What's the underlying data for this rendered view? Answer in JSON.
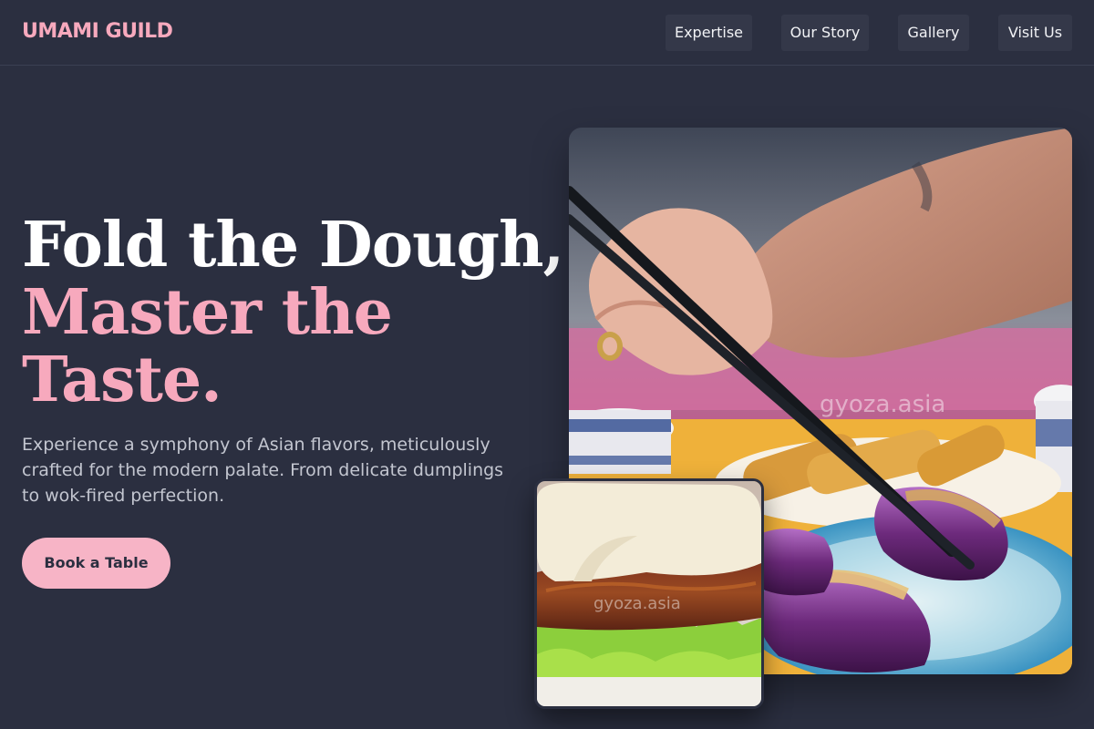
{
  "brand": {
    "logo_text": "UMAMI GUILD"
  },
  "nav": {
    "items": [
      {
        "label": "Expertise"
      },
      {
        "label": "Our Story"
      },
      {
        "label": "Gallery"
      },
      {
        "label": "Visit Us"
      }
    ]
  },
  "hero": {
    "headline_line1": "Fold the Dough,",
    "headline_accent": "Master the Taste.",
    "description": "Experience a symphony of Asian flavors, meticulously crafted for the modern palate. From delicate dumplings to wok-fired perfection.",
    "cta_label": "Book a Table"
  },
  "images": {
    "main_watermark": "gyoza.asia",
    "secondary_watermark": "gyoza.asia"
  },
  "colors": {
    "background": "#2b2f40",
    "accent_pink": "#f7a9bd",
    "button_pink": "#f7b4c6",
    "nav_button_bg": "#343849"
  }
}
